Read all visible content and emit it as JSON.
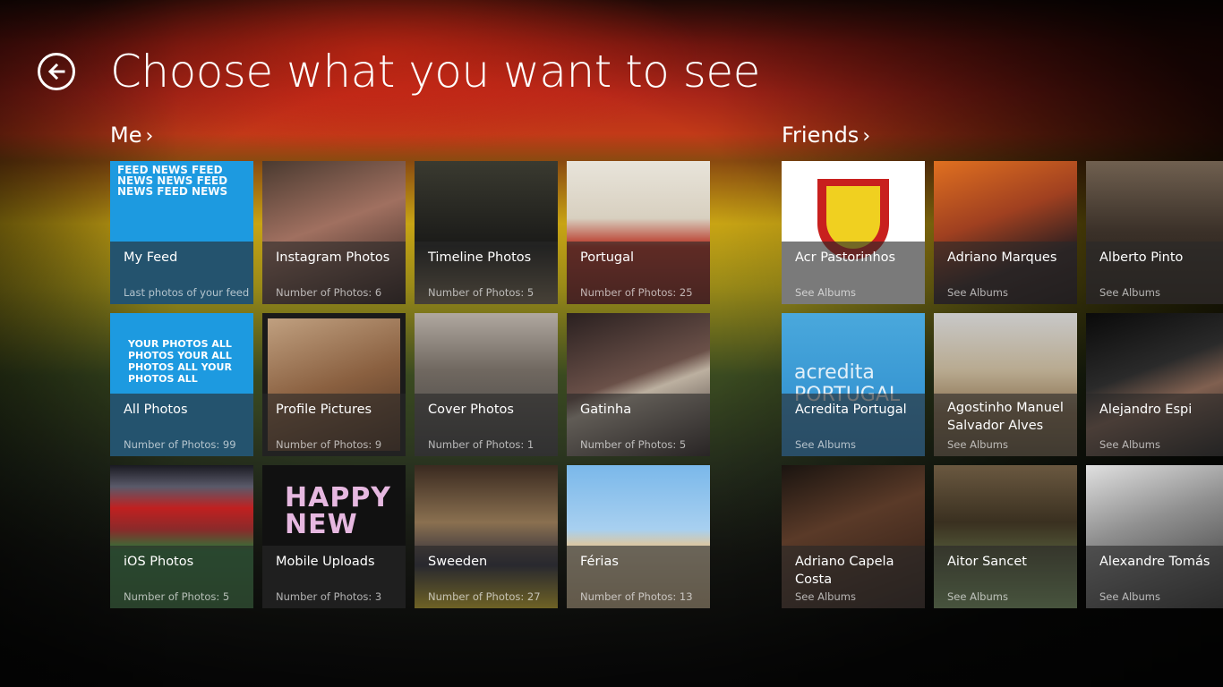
{
  "page": {
    "title": "Choose what you want to see",
    "back_icon": "back-arrow-icon"
  },
  "sections": {
    "me": {
      "label": "Me",
      "chevron": "›"
    },
    "friends": {
      "label": "Friends",
      "chevron": "›"
    }
  },
  "me_tiles": [
    {
      "name": "My Feed",
      "sub": "Last photos of your feed",
      "thumb_text": "FEED NEWS FEED NEWS NEWS FEED NEWS FEED NEWS"
    },
    {
      "name": "Instagram Photos",
      "sub": "Number of Photos: 6"
    },
    {
      "name": "Timeline Photos",
      "sub": "Number of Photos: 5"
    },
    {
      "name": "Portugal",
      "sub": "Number of Photos: 25"
    },
    {
      "name": "All Photos",
      "sub": "Number of Photos: 99",
      "thumb_text": "YOUR PHOTOS ALL PHOTOS YOUR ALL PHOTOS ALL YOUR PHOTOS ALL"
    },
    {
      "name": "Profile Pictures",
      "sub": "Number of Photos: 9"
    },
    {
      "name": "Cover Photos",
      "sub": "Number of Photos: 1"
    },
    {
      "name": "Gatinha",
      "sub": "Number of Photos: 5"
    },
    {
      "name": "iOS Photos",
      "sub": "Number of Photos: 5"
    },
    {
      "name": "Mobile Uploads",
      "sub": "Number of Photos: 3",
      "thumb_text": "HAPPY NEW"
    },
    {
      "name": "Sweeden",
      "sub": "Number of Photos: 27"
    },
    {
      "name": "Férias",
      "sub": "Number of Photos: 13"
    }
  ],
  "friends_tiles": [
    {
      "name": "Acr Pastorinhos",
      "sub": "See Albums"
    },
    {
      "name": "Adriano Marques",
      "sub": "See Albums"
    },
    {
      "name": "Alberto Pinto",
      "sub": "See Albums"
    },
    {
      "name": "Acredita Portugal",
      "sub": "See Albums",
      "thumb_text": "acredita PORTUGAL"
    },
    {
      "name": "Agostinho Manuel Salvador Alves",
      "sub": "See Albums"
    },
    {
      "name": "Alejandro Espi",
      "sub": "See Albums"
    },
    {
      "name": "Adriano Capela Costa",
      "sub": "See Albums"
    },
    {
      "name": "Aitor Sancet",
      "sub": "See Albums"
    },
    {
      "name": "Alexandre Tomás",
      "sub": "See Albums"
    }
  ]
}
